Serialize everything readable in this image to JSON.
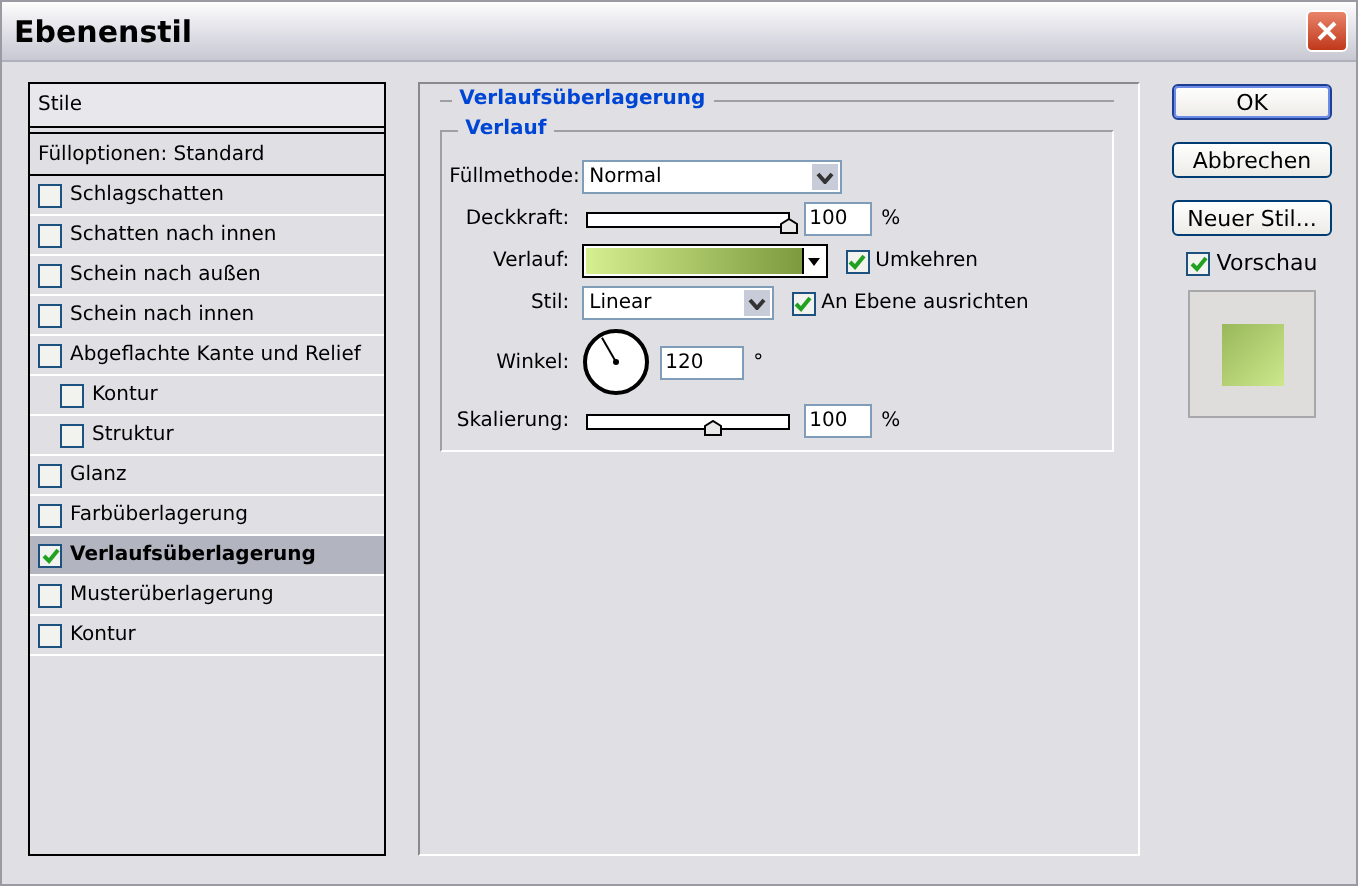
{
  "window": {
    "title": "Ebenenstil"
  },
  "styles_list": {
    "header": "Stile",
    "blend_options": "Fülloptionen: Standard",
    "items": [
      {
        "label": "Schlagschatten",
        "checked": false,
        "selected": false
      },
      {
        "label": "Schatten nach innen",
        "checked": false,
        "selected": false
      },
      {
        "label": "Schein nach außen",
        "checked": false,
        "selected": false
      },
      {
        "label": "Schein nach innen",
        "checked": false,
        "selected": false
      },
      {
        "label": "Abgeflachte Kante und Relief",
        "checked": false,
        "selected": false,
        "children": [
          {
            "label": "Kontur",
            "checked": false,
            "selected": false
          },
          {
            "label": "Struktur",
            "checked": false,
            "selected": false
          }
        ]
      },
      {
        "label": "Glanz",
        "checked": false,
        "selected": false
      },
      {
        "label": "Farbüberlagerung",
        "checked": false,
        "selected": false
      },
      {
        "label": "Verlaufsüberlagerung",
        "checked": true,
        "selected": true
      },
      {
        "label": "Musterüberlagerung",
        "checked": false,
        "selected": false
      },
      {
        "label": "Kontur",
        "checked": false,
        "selected": false
      }
    ]
  },
  "panel": {
    "title": "Verlaufsüberlagerung",
    "group": "Verlauf",
    "fields": [
      {
        "kind": "select",
        "label": "Füllmethode:",
        "value": "Normal"
      },
      {
        "kind": "slider",
        "label": "Deckkraft:",
        "level": 1,
        "value": "100",
        "unit": "%"
      },
      {
        "kind": "gradient",
        "label": "Verlauf:",
        "checkbox": {
          "label": "Umkehren",
          "checked": true
        }
      },
      {
        "kind": "select",
        "label": "Stil:",
        "value": "Linear",
        "checkbox": {
          "label": "An Ebene ausrichten",
          "checked": true
        }
      },
      {
        "kind": "angle",
        "label": "Winkel:",
        "value": "120",
        "unit": "°"
      },
      {
        "kind": "slider",
        "label": "Skalierung:",
        "level": 0.62,
        "value": "100",
        "unit": "%"
      }
    ]
  },
  "buttons": [
    {
      "label": "OK",
      "default": true
    },
    {
      "label": "Abbrechen",
      "default": false
    },
    {
      "label": "Neuer Stil...",
      "default": false
    }
  ],
  "preview": {
    "label": "Vorschau",
    "checked": true
  }
}
